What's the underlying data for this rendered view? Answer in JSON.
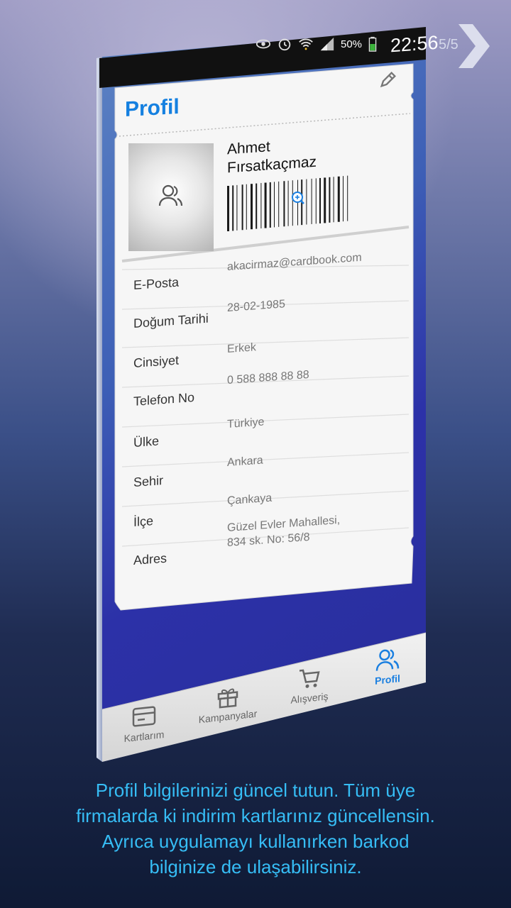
{
  "pager": {
    "label": "5/5"
  },
  "status_bar": {
    "battery_percent": "50%",
    "time": "22:56"
  },
  "header": {
    "title": "Profil"
  },
  "profile": {
    "name": "Ahmet\nFırsatkaçmaz"
  },
  "fields": [
    {
      "label": "E-Posta",
      "value": "akacirmaz@cardbook.com"
    },
    {
      "label": "Doğum Tarihi",
      "value": "28-02-1985"
    },
    {
      "label": "Cinsiyet",
      "value": "Erkek"
    },
    {
      "label": "Telefon No",
      "value": "0 588 888 88 88"
    },
    {
      "label": "Ülke",
      "value": "Türkiye"
    },
    {
      "label": "Sehir",
      "value": "Ankara"
    },
    {
      "label": "İlçe",
      "value": "Çankaya"
    },
    {
      "label": "Adres",
      "value": "Güzel Evler Mahallesi,\n834 sk. No: 56/8"
    }
  ],
  "bottom_nav": [
    {
      "label": "Kartlarım"
    },
    {
      "label": "Kampanyalar"
    },
    {
      "label": "Alışveriş"
    },
    {
      "label": "Profil"
    }
  ],
  "caption": {
    "line1": "Profil bilgilerinizi güncel tutun. Tüm üye",
    "line2": "firmalarda ki indirim kartlarınız güncellensin.",
    "line3": "Ayrıca uygulamayı kullanırken barkod",
    "line4": "bilginize de ulaşabilirsiniz."
  },
  "colors": {
    "accent": "#1580e0",
    "caption": "#36bdf5"
  }
}
